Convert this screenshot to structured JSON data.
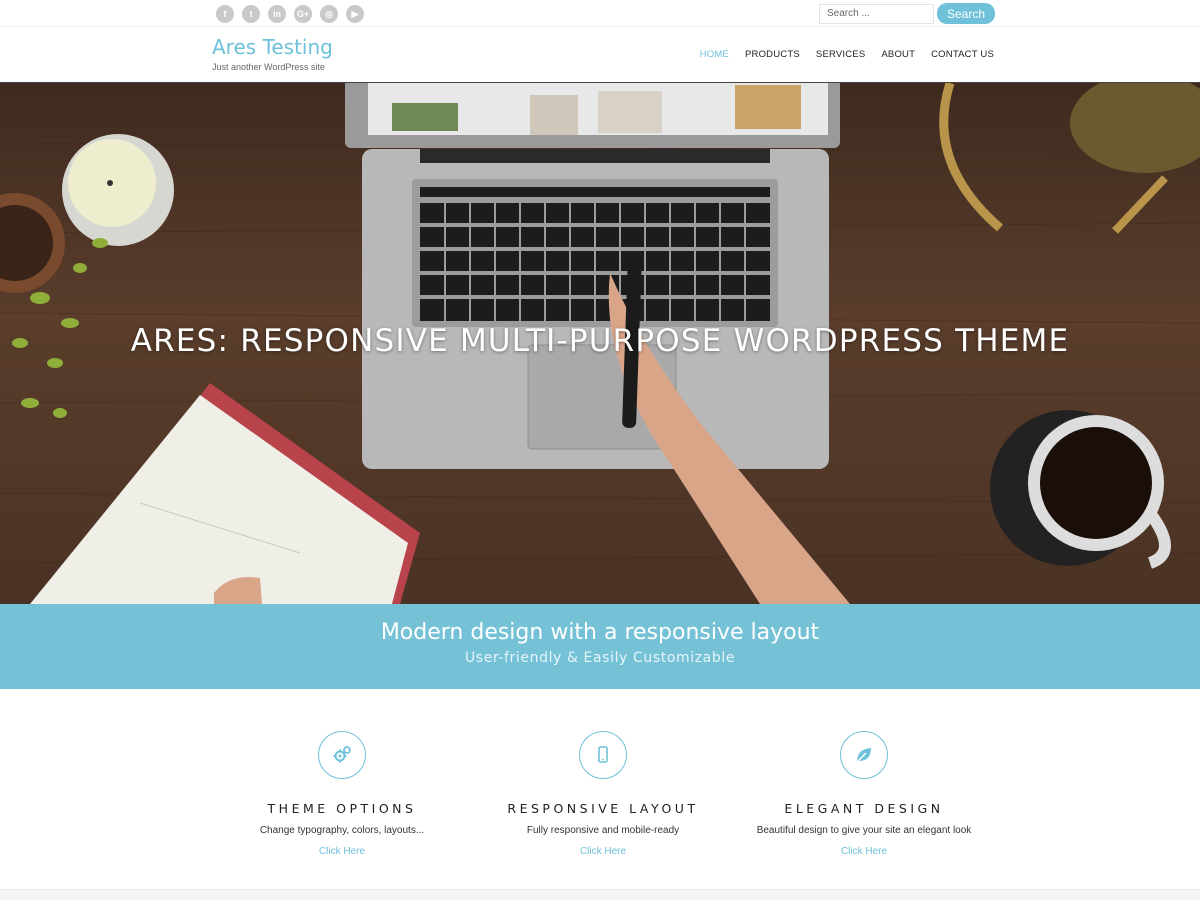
{
  "social": {
    "icons": [
      {
        "name": "facebook-icon",
        "glyph": "f"
      },
      {
        "name": "twitter-icon",
        "glyph": "t"
      },
      {
        "name": "linkedin-icon",
        "glyph": "in"
      },
      {
        "name": "googleplus-icon",
        "glyph": "G+"
      },
      {
        "name": "instagram-icon",
        "glyph": "◎"
      },
      {
        "name": "youtube-icon",
        "glyph": "▶"
      }
    ]
  },
  "search": {
    "placeholder": "Search ...",
    "button_label": "Search"
  },
  "site": {
    "title": "Ares Testing",
    "description": "Just another WordPress site"
  },
  "nav": {
    "items": [
      "HOME",
      "PRODUCTS",
      "SERVICES",
      "ABOUT",
      "CONTACT US"
    ],
    "active": "HOME"
  },
  "hero": {
    "title": "ARES: RESPONSIVE MULTI-PURPOSE WORDPRESS THEME"
  },
  "banner": {
    "title": "Modern design with a responsive layout",
    "subtitle": "User-friendly & Easily Customizable"
  },
  "features": [
    {
      "title": "THEME OPTIONS",
      "description": "Change typography, colors, layouts...",
      "link": "Click Here",
      "icon": "gears-icon"
    },
    {
      "title": "RESPONSIVE LAYOUT",
      "description": "Fully responsive and mobile-ready",
      "link": "Click Here",
      "icon": "mobile-icon"
    },
    {
      "title": "ELEGANT DESIGN",
      "description": "Beautiful design to give your site an elegant look",
      "link": "Click Here",
      "icon": "leaf-icon"
    }
  ],
  "colors": {
    "accent": "#6ec1d9",
    "banner": "#75c2d7"
  }
}
